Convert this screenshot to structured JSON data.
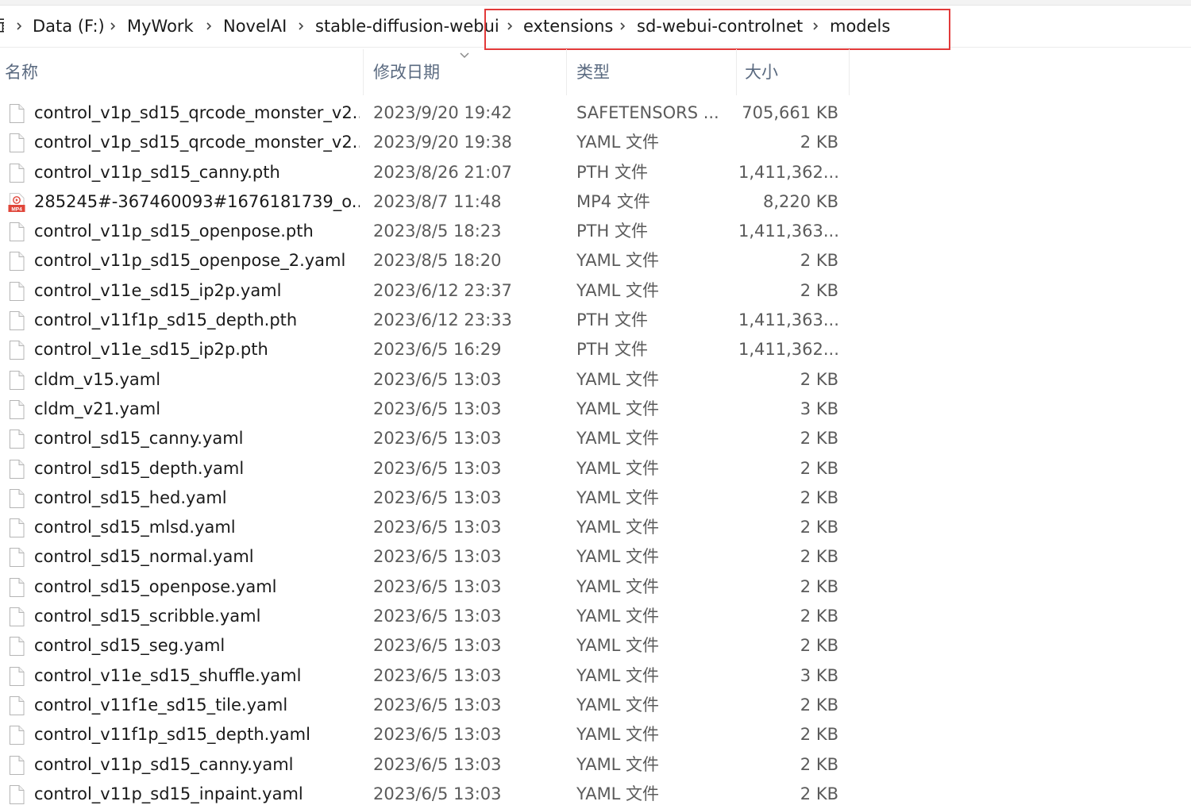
{
  "breadcrumb": {
    "partial": "面",
    "items": [
      "Data (F:)",
      "MyWork",
      "NovelAI",
      "stable-diffusion-webui",
      "extensions",
      "sd-webui-controlnet",
      "models"
    ]
  },
  "columns": {
    "name": "名称",
    "date": "修改日期",
    "type": "类型",
    "size": "大小"
  },
  "files": [
    {
      "name": "control_v1p_sd15_qrcode_monster_v2...",
      "date": "2023/9/20 19:42",
      "type": "SAFETENSORS ...",
      "size": "705,661 KB",
      "icon": "blank-file-icon"
    },
    {
      "name": "control_v1p_sd15_qrcode_monster_v2...",
      "date": "2023/9/20 19:38",
      "type": "YAML 文件",
      "size": "2 KB",
      "icon": "blank-file-icon"
    },
    {
      "name": "control_v11p_sd15_canny.pth",
      "date": "2023/8/26 21:07",
      "type": "PTH 文件",
      "size": "1,411,362...",
      "icon": "blank-file-icon"
    },
    {
      "name": "285245#-367460093#1676181739_o...",
      "date": "2023/8/7 11:48",
      "type": "MP4 文件",
      "size": "8,220 KB",
      "icon": "mp4-file-icon"
    },
    {
      "name": "control_v11p_sd15_openpose.pth",
      "date": "2023/8/5 18:23",
      "type": "PTH 文件",
      "size": "1,411,363...",
      "icon": "blank-file-icon"
    },
    {
      "name": "control_v11p_sd15_openpose_2.yaml",
      "date": "2023/8/5 18:20",
      "type": "YAML 文件",
      "size": "2 KB",
      "icon": "blank-file-icon"
    },
    {
      "name": "control_v11e_sd15_ip2p.yaml",
      "date": "2023/6/12 23:37",
      "type": "YAML 文件",
      "size": "2 KB",
      "icon": "blank-file-icon"
    },
    {
      "name": "control_v11f1p_sd15_depth.pth",
      "date": "2023/6/12 23:33",
      "type": "PTH 文件",
      "size": "1,411,363...",
      "icon": "blank-file-icon"
    },
    {
      "name": "control_v11e_sd15_ip2p.pth",
      "date": "2023/6/5 16:29",
      "type": "PTH 文件",
      "size": "1,411,362...",
      "icon": "blank-file-icon"
    },
    {
      "name": "cldm_v15.yaml",
      "date": "2023/6/5 13:03",
      "type": "YAML 文件",
      "size": "2 KB",
      "icon": "blank-file-icon"
    },
    {
      "name": "cldm_v21.yaml",
      "date": "2023/6/5 13:03",
      "type": "YAML 文件",
      "size": "3 KB",
      "icon": "blank-file-icon"
    },
    {
      "name": "control_sd15_canny.yaml",
      "date": "2023/6/5 13:03",
      "type": "YAML 文件",
      "size": "2 KB",
      "icon": "blank-file-icon"
    },
    {
      "name": "control_sd15_depth.yaml",
      "date": "2023/6/5 13:03",
      "type": "YAML 文件",
      "size": "2 KB",
      "icon": "blank-file-icon"
    },
    {
      "name": "control_sd15_hed.yaml",
      "date": "2023/6/5 13:03",
      "type": "YAML 文件",
      "size": "2 KB",
      "icon": "blank-file-icon"
    },
    {
      "name": "control_sd15_mlsd.yaml",
      "date": "2023/6/5 13:03",
      "type": "YAML 文件",
      "size": "2 KB",
      "icon": "blank-file-icon"
    },
    {
      "name": "control_sd15_normal.yaml",
      "date": "2023/6/5 13:03",
      "type": "YAML 文件",
      "size": "2 KB",
      "icon": "blank-file-icon"
    },
    {
      "name": "control_sd15_openpose.yaml",
      "date": "2023/6/5 13:03",
      "type": "YAML 文件",
      "size": "2 KB",
      "icon": "blank-file-icon"
    },
    {
      "name": "control_sd15_scribble.yaml",
      "date": "2023/6/5 13:03",
      "type": "YAML 文件",
      "size": "2 KB",
      "icon": "blank-file-icon"
    },
    {
      "name": "control_sd15_seg.yaml",
      "date": "2023/6/5 13:03",
      "type": "YAML 文件",
      "size": "2 KB",
      "icon": "blank-file-icon"
    },
    {
      "name": "control_v11e_sd15_shuffle.yaml",
      "date": "2023/6/5 13:03",
      "type": "YAML 文件",
      "size": "3 KB",
      "icon": "blank-file-icon"
    },
    {
      "name": "control_v11f1e_sd15_tile.yaml",
      "date": "2023/6/5 13:03",
      "type": "YAML 文件",
      "size": "2 KB",
      "icon": "blank-file-icon"
    },
    {
      "name": "control_v11f1p_sd15_depth.yaml",
      "date": "2023/6/5 13:03",
      "type": "YAML 文件",
      "size": "2 KB",
      "icon": "blank-file-icon"
    },
    {
      "name": "control_v11p_sd15_canny.yaml",
      "date": "2023/6/5 13:03",
      "type": "YAML 文件",
      "size": "2 KB",
      "icon": "blank-file-icon"
    },
    {
      "name": "control_v11p_sd15_inpaint.yaml",
      "date": "2023/6/5 13:03",
      "type": "YAML 文件",
      "size": "2 KB",
      "icon": "blank-file-icon"
    }
  ],
  "colors": {
    "highlight": "#e23a3a",
    "header_text": "#5a6a80",
    "mp4_icon": "#e0463a"
  },
  "icons": {
    "separator": "chevron-right-icon",
    "sort": "chevron-down-icon",
    "file": "blank-file-icon",
    "video": "mp4-file-icon",
    "video_label": "MP4"
  }
}
